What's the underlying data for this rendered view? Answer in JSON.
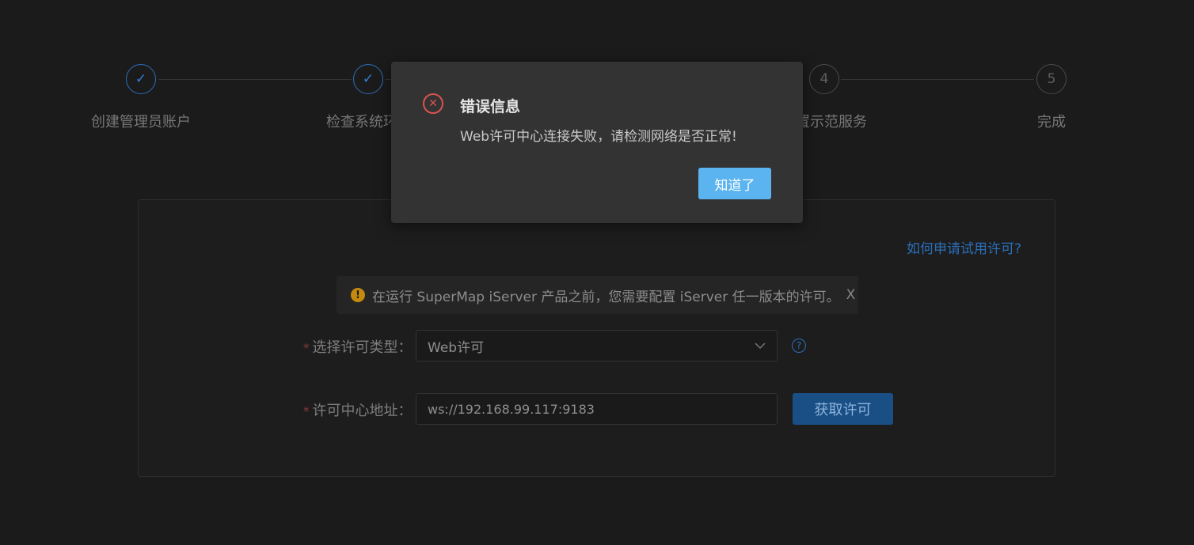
{
  "steps": [
    {
      "label": "创建管理员账户",
      "state": "done",
      "marker": "✓"
    },
    {
      "label": "检查系统环",
      "state": "done",
      "marker": "✓"
    },
    {
      "label": "",
      "state": "hidden",
      "marker": ""
    },
    {
      "label": "置示范服务",
      "state": "todo",
      "marker": "4"
    },
    {
      "label": "完成",
      "state": "todo",
      "marker": "5"
    }
  ],
  "help_link": "如何申请试用许可?",
  "alert": {
    "text": "在运行 SuperMap iServer 产品之前，您需要配置 iServer 任一版本的许可。",
    "close": "X"
  },
  "form": {
    "license_type_label": "选择许可类型：",
    "license_type_value": "Web许可",
    "license_center_label": "许可中心地址：",
    "license_center_value": "ws://192.168.99.117:9183",
    "required_mark": "*",
    "get_license_button": "获取许可"
  },
  "modal": {
    "title": "错误信息",
    "message": "Web许可中心连接失败，请检测网络是否正常!",
    "ok_button": "知道了"
  },
  "colors": {
    "accent": "#2a6fb8",
    "error": "#d9534f",
    "warning": "#c48a0e",
    "ok_button": "#5bb4f0"
  }
}
